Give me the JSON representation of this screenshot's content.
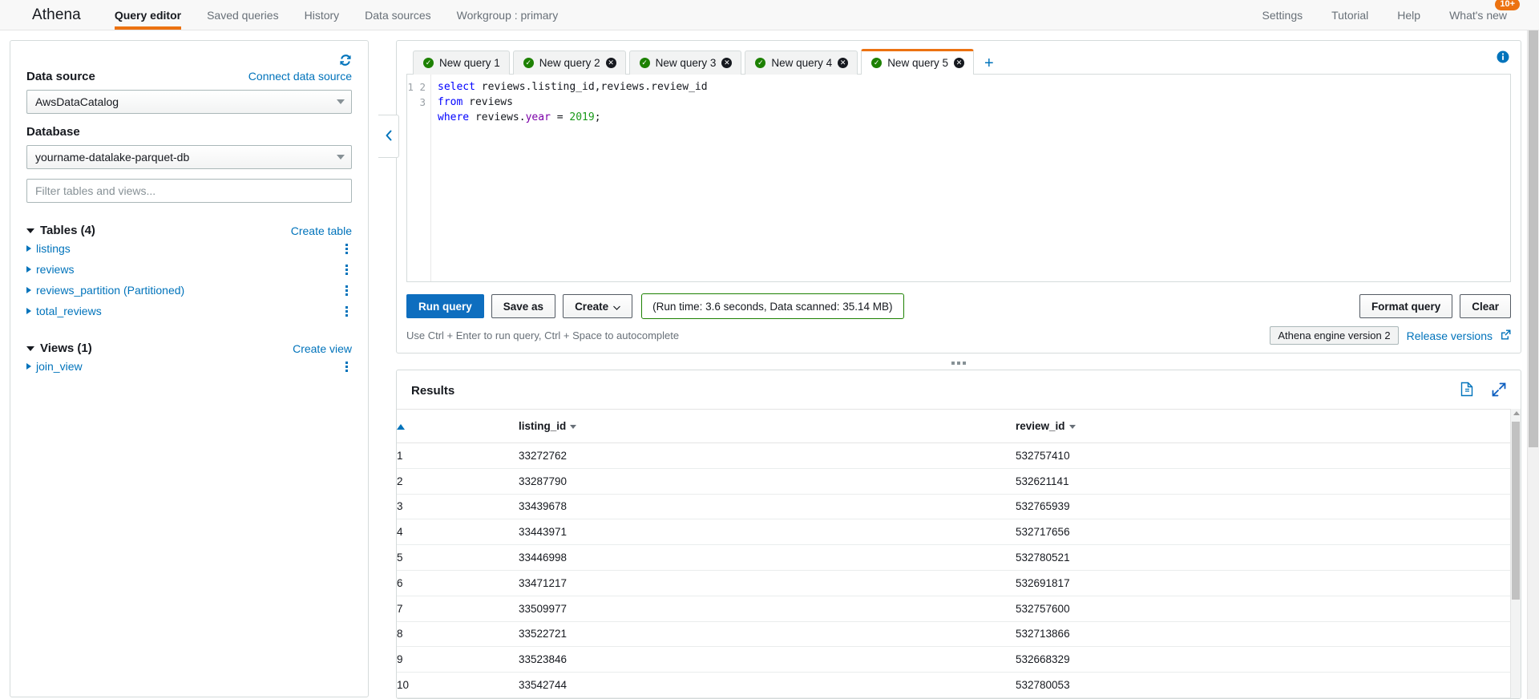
{
  "topnav": {
    "brand": "Athena",
    "items": [
      {
        "label": "Query editor",
        "active": true
      },
      {
        "label": "Saved queries",
        "active": false
      },
      {
        "label": "History",
        "active": false
      },
      {
        "label": "Data sources",
        "active": false
      },
      {
        "label": "Workgroup : primary",
        "active": false
      }
    ],
    "right_items": [
      {
        "label": "Settings"
      },
      {
        "label": "Tutorial"
      },
      {
        "label": "Help"
      },
      {
        "label": "What's new",
        "badge": "10+"
      }
    ],
    "badge_color": "#ec7211"
  },
  "sidebar": {
    "refresh_icon": "refresh-icon",
    "data_source_label": "Data source",
    "connect_link": "Connect data source",
    "data_source_value": "AwsDataCatalog",
    "database_label": "Database",
    "database_value": "yourname-datalake-parquet-db",
    "filter_placeholder": "Filter tables and views...",
    "filter_value": "",
    "tables_section": {
      "title": "Tables (4)",
      "action": "Create table",
      "items": [
        {
          "label": "listings"
        },
        {
          "label": "reviews"
        },
        {
          "label": "reviews_partition (Partitioned)"
        },
        {
          "label": "total_reviews"
        }
      ]
    },
    "views_section": {
      "title": "Views (1)",
      "action": "Create view",
      "items": [
        {
          "label": "join_view"
        }
      ]
    }
  },
  "editor": {
    "info_icon": "info-icon",
    "collapse_icon": "chevron-left-icon",
    "tabs": [
      {
        "label": "New query 1",
        "active": false,
        "closable": false
      },
      {
        "label": "New query 2",
        "active": false,
        "closable": true
      },
      {
        "label": "New query 3",
        "active": false,
        "closable": true
      },
      {
        "label": "New query 4",
        "active": false,
        "closable": true
      },
      {
        "label": "New query 5",
        "active": true,
        "closable": true
      }
    ],
    "add_tab_label": "+",
    "line_numbers": [
      "1",
      "2",
      "3"
    ],
    "sql": {
      "line1": {
        "kw": "select",
        "body": " reviews.listing_id,reviews.review_id"
      },
      "line2": {
        "kw": "from",
        "body": " reviews"
      },
      "line3": {
        "kw": "where",
        "body": " reviews.",
        "prop": "year",
        "op": " = ",
        "num": "2019",
        "end": ";"
      }
    },
    "raw_sql": "select reviews.listing_id,reviews.review_id\nfrom reviews\nwhere reviews.year = 2019;"
  },
  "toolbar": {
    "run_label": "Run query",
    "save_label": "Save as",
    "create_label": "Create",
    "status": "(Run time: 3.6 seconds, Data scanned: 35.14 MB)",
    "status_border_color": "#1d8102",
    "format_label": "Format query",
    "clear_label": "Clear",
    "hint": "Use Ctrl + Enter to run query, Ctrl + Space to autocomplete",
    "engine_chip": "Athena engine version 2",
    "release_link": "Release versions",
    "external_icon": "external-link-icon",
    "primary_color": "#0e6ebf"
  },
  "results": {
    "title": "Results",
    "download_icon": "download-file-icon",
    "expand_icon": "expand-icon",
    "sort_indicator_icon": "sort-ascending-icon",
    "columns": [
      "",
      "listing_id",
      "review_id"
    ],
    "rows": [
      {
        "idx": "1",
        "listing_id": "33272762",
        "review_id": "532757410"
      },
      {
        "idx": "2",
        "listing_id": "33287790",
        "review_id": "532621141"
      },
      {
        "idx": "3",
        "listing_id": "33439678",
        "review_id": "532765939"
      },
      {
        "idx": "4",
        "listing_id": "33443971",
        "review_id": "532717656"
      },
      {
        "idx": "5",
        "listing_id": "33446998",
        "review_id": "532780521"
      },
      {
        "idx": "6",
        "listing_id": "33471217",
        "review_id": "532691817"
      },
      {
        "idx": "7",
        "listing_id": "33509977",
        "review_id": "532757600"
      },
      {
        "idx": "8",
        "listing_id": "33522721",
        "review_id": "532713866"
      },
      {
        "idx": "9",
        "listing_id": "33523846",
        "review_id": "532668329"
      },
      {
        "idx": "10",
        "listing_id": "33542744",
        "review_id": "532780053"
      }
    ]
  }
}
